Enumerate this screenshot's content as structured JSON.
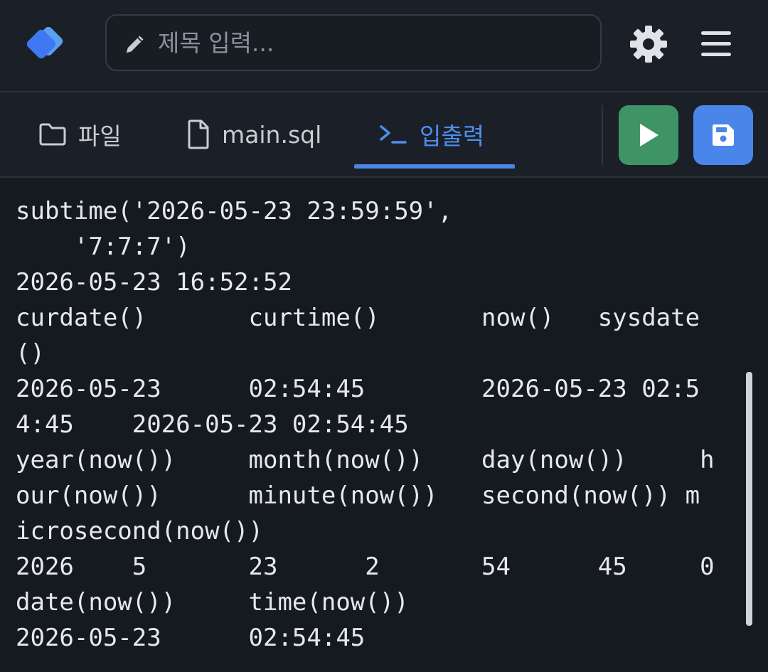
{
  "header": {
    "title_placeholder": "제목 입력...",
    "icons": {
      "logo": "logo-diamonds",
      "pencil": "pencil-icon",
      "settings": "gear-icon",
      "menu": "hamburger-menu-icon"
    }
  },
  "tabs": [
    {
      "label": "파일",
      "icon": "folder-icon",
      "active": false
    },
    {
      "label": "main.sql",
      "icon": "file-icon",
      "active": false
    },
    {
      "label": "입출력",
      "icon": "terminal-icon",
      "active": true
    }
  ],
  "actions": {
    "run_icon": "play-icon",
    "save_icon": "save-icon"
  },
  "console": {
    "lines": [
      "subtime('2026-05-23 23:59:59',",
      "    '7:7:7')",
      "2026-05-23 16:52:52",
      "curdate()       curtime()       now()   sysdate",
      "()",
      "2026-05-23      02:54:45        2026-05-23 02:5",
      "4:45    2026-05-23 02:54:45",
      "year(now())     month(now())    day(now())     h",
      "our(now())      minute(now())   second(now()) m",
      "icrosecond(now())",
      "2026    5       23      2       54      45     0",
      "date(now())     time(now())",
      "2026-05-23      02:54:45"
    ]
  },
  "colors": {
    "background": "#151a21",
    "bar": "#1b2028",
    "accent_blue": "#4a86ea",
    "run_green": "#3f9466"
  }
}
